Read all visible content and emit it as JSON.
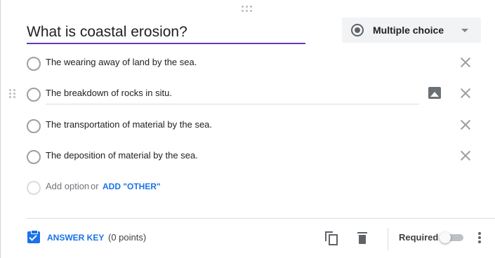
{
  "question": {
    "title": "What is coastal erosion?",
    "type_label": "Multiple choice"
  },
  "options": [
    {
      "label": "The wearing away of land by the sea."
    },
    {
      "label": "The breakdown of rocks in situ."
    },
    {
      "label": "The transportation of material by the sea."
    },
    {
      "label": "The deposition of material by the sea."
    }
  ],
  "add_option": {
    "label": "Add option",
    "or": "or",
    "other": "ADD \"OTHER\""
  },
  "footer": {
    "answer_key": "ANSWER KEY",
    "points": "(0 points)",
    "required": "Required",
    "required_on": false
  },
  "colors": {
    "accent": "#673ab7",
    "link": "#1a73e8"
  },
  "icons": [
    "drag-handle-icon",
    "radio-filled-icon",
    "chevron-down-icon",
    "close-icon",
    "image-icon",
    "answer-key-icon",
    "copy-icon",
    "delete-icon",
    "more-vert-icon"
  ]
}
